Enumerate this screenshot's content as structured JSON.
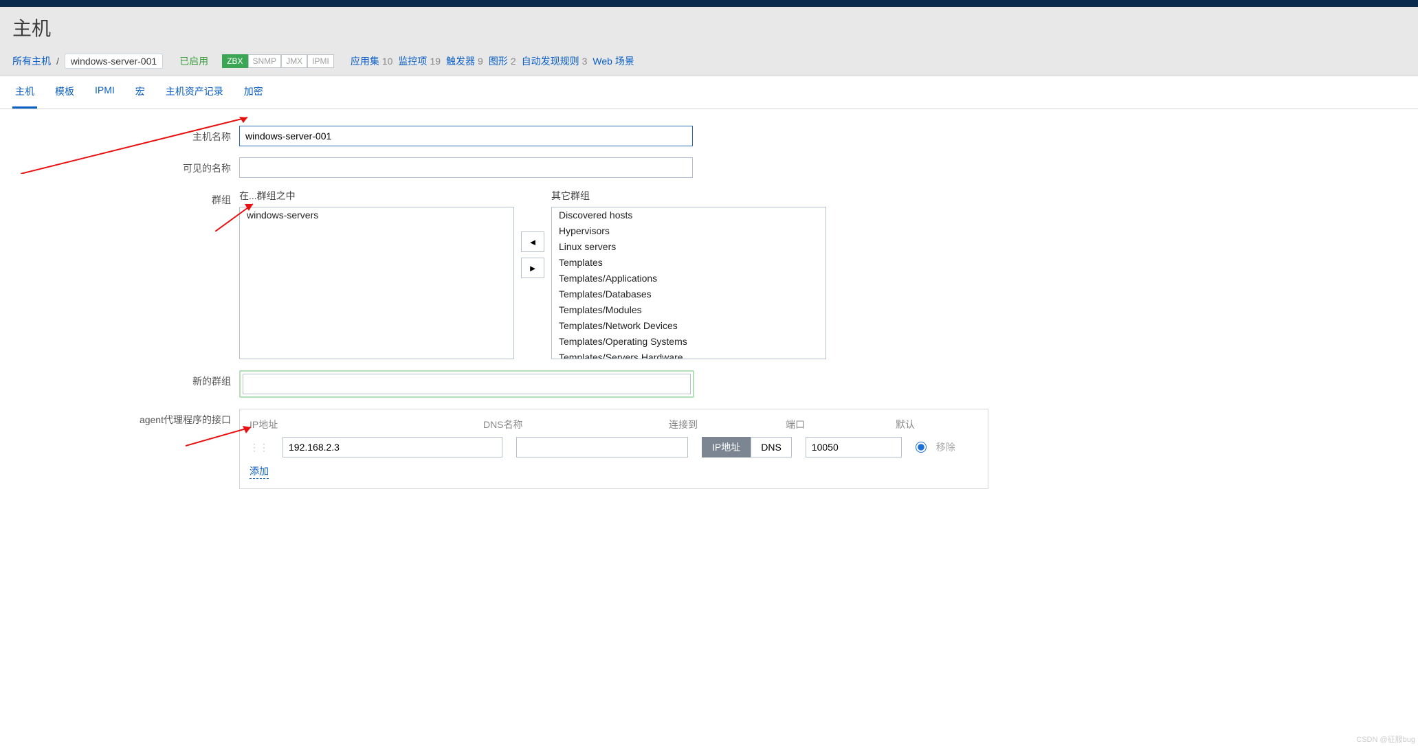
{
  "page_title": "主机",
  "breadcrumb": {
    "all_hosts": "所有主机",
    "host": "windows-server-001",
    "status": "已启用",
    "availability": {
      "zbx": "ZBX",
      "snmp": "SNMP",
      "jmx": "JMX",
      "ipmi": "IPMI"
    },
    "metrics": [
      {
        "label": "应用集",
        "count": "10"
      },
      {
        "label": "监控项",
        "count": "19"
      },
      {
        "label": "触发器",
        "count": "9"
      },
      {
        "label": "图形",
        "count": "2"
      },
      {
        "label": "自动发现规则",
        "count": "3"
      },
      {
        "label": "Web 场景",
        "count": ""
      }
    ]
  },
  "tabs": [
    "主机",
    "模板",
    "IPMI",
    "宏",
    "主机资产记录",
    "加密"
  ],
  "form": {
    "labels": {
      "host_name": "主机名称",
      "visible_name": "可见的名称",
      "groups": "群组",
      "in_groups": "在...群组之中",
      "other_groups": "其它群组",
      "new_group": "新的群组",
      "agent_if": "agent代理程序的接口"
    },
    "host_name": "windows-server-001",
    "visible_name": "",
    "in_groups": [
      "windows-servers"
    ],
    "other_groups": [
      "Discovered hosts",
      "Hypervisors",
      "Linux servers",
      "Templates",
      "Templates/Applications",
      "Templates/Databases",
      "Templates/Modules",
      "Templates/Network Devices",
      "Templates/Operating Systems",
      "Templates/Servers Hardware"
    ],
    "new_group": "",
    "iface": {
      "headers": {
        "ip": "IP地址",
        "dns": "DNS名称",
        "connect": "连接到",
        "port": "端口",
        "default": "默认"
      },
      "ip": "192.168.2.3",
      "dns": "",
      "connect_ip": "IP地址",
      "connect_dns": "DNS",
      "port": "10050",
      "remove": "移除",
      "add": "添加"
    }
  },
  "watermark": "CSDN @征服bug"
}
